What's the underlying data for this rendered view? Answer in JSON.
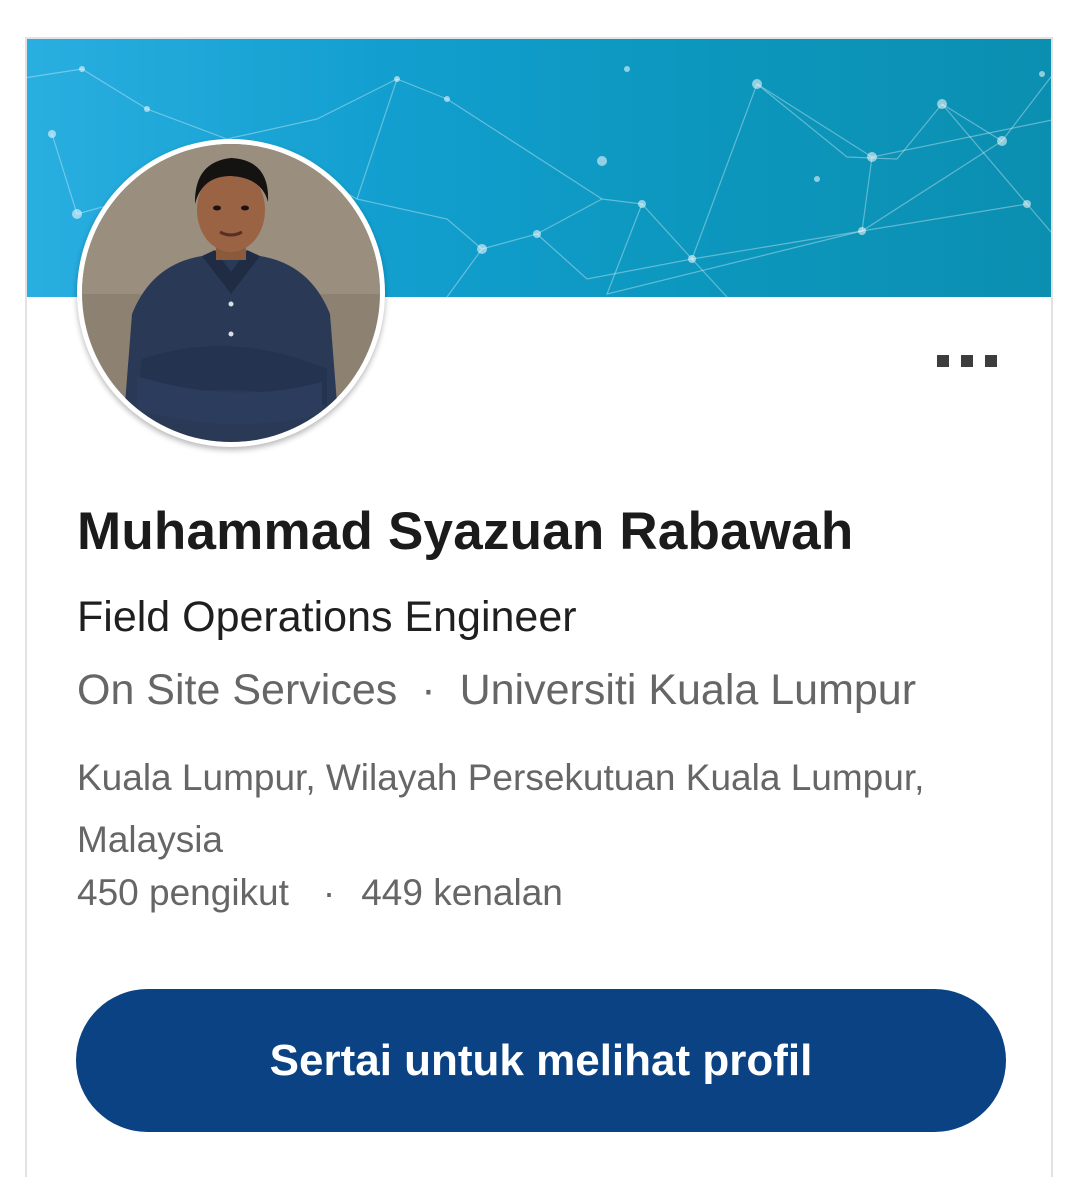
{
  "profile": {
    "name": "Muhammad Syazuan Rabawah",
    "headline": "Field Operations Engineer",
    "company": "On Site Services",
    "separator": "·",
    "school": "Universiti Kuala Lumpur",
    "location": "Kuala Lumpur, Wilayah Persekutuan Kuala Lumpur, Malaysia",
    "followers": "450 pengikut",
    "connections": "449 kenalan"
  },
  "actions": {
    "more_icon": "more-horizontal-icon",
    "join_label": "Sertai untuk melihat profil"
  },
  "colors": {
    "banner": "#129fcf",
    "button": "#0a4284",
    "name_text": "#1b1b1b",
    "secondary_text": "#666666"
  }
}
